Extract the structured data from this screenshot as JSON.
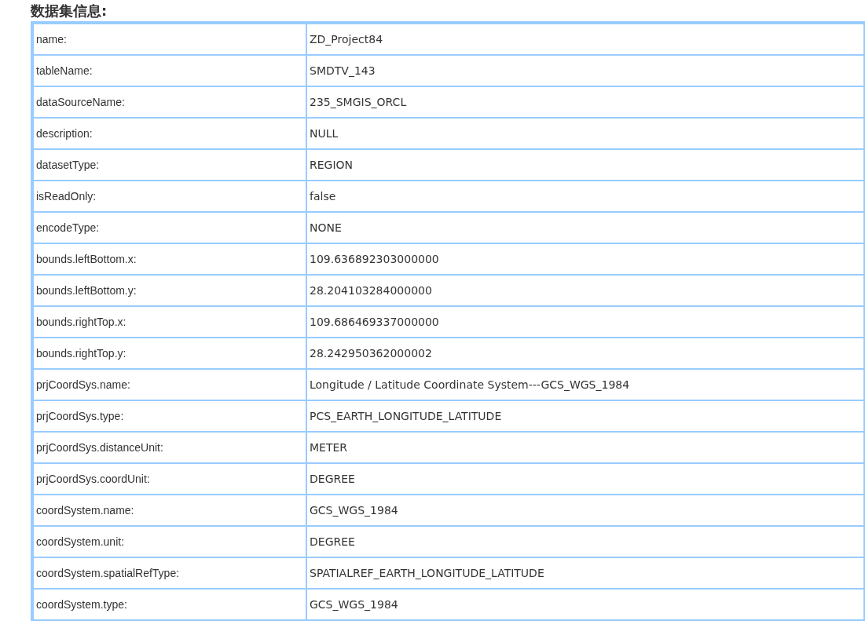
{
  "heading": "数据集信息:",
  "rows": [
    {
      "key": "name:",
      "value": "ZD_Project84"
    },
    {
      "key": "tableName:",
      "value": "SMDTV_143"
    },
    {
      "key": "dataSourceName:",
      "value": "235_SMGIS_ORCL"
    },
    {
      "key": "description:",
      "value": "NULL"
    },
    {
      "key": "datasetType:",
      "value": "REGION"
    },
    {
      "key": "isReadOnly:",
      "value": "false"
    },
    {
      "key": "encodeType:",
      "value": "NONE"
    },
    {
      "key": "bounds.leftBottom.x:",
      "value": "109.636892303000000"
    },
    {
      "key": "bounds.leftBottom.y:",
      "value": "28.204103284000000"
    },
    {
      "key": "bounds.rightTop.x:",
      "value": "109.686469337000000"
    },
    {
      "key": "bounds.rightTop.y:",
      "value": "28.242950362000002"
    },
    {
      "key": "prjCoordSys.name:",
      "value": "Longitude / Latitude Coordinate System---GCS_WGS_1984"
    },
    {
      "key": "prjCoordSys.type:",
      "value": "PCS_EARTH_LONGITUDE_LATITUDE"
    },
    {
      "key": "prjCoordSys.distanceUnit:",
      "value": "METER"
    },
    {
      "key": "prjCoordSys.coordUnit:",
      "value": "DEGREE"
    },
    {
      "key": "coordSystem.name:",
      "value": "GCS_WGS_1984"
    },
    {
      "key": "coordSystem.unit:",
      "value": "DEGREE"
    },
    {
      "key": "coordSystem.spatialRefType:",
      "value": "SPATIALREF_EARTH_LONGITUDE_LATITUDE"
    },
    {
      "key": "coordSystem.type:",
      "value": "GCS_WGS_1984"
    }
  ]
}
